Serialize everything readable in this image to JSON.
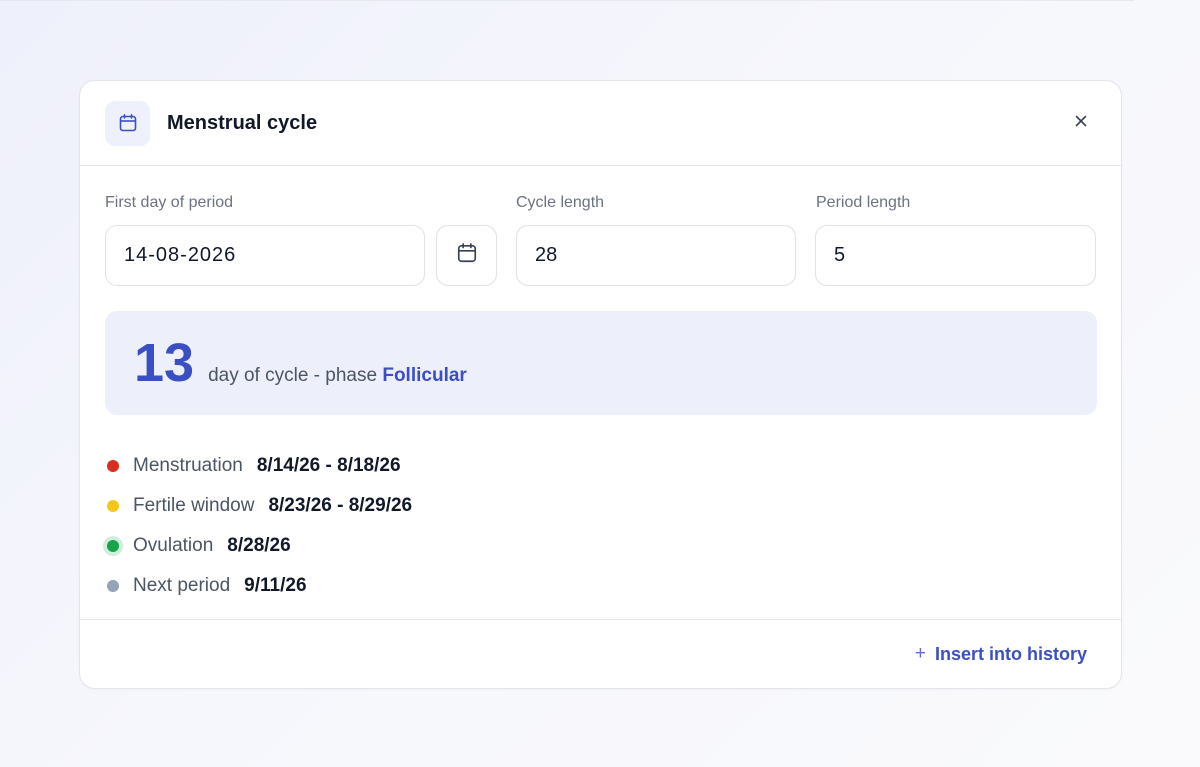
{
  "dialog": {
    "title": "Menstrual cycle",
    "header_icon": "calendar-icon",
    "close_icon": "close-icon"
  },
  "form": {
    "first_day_label": "First day of period",
    "first_day_value": "14-08-2026",
    "date_picker_icon": "calendar-icon",
    "cycle_length_label": "Cycle length",
    "cycle_length_value": "28",
    "period_length_label": "Period length",
    "period_length_value": "5"
  },
  "summary": {
    "day_number": "13",
    "text": "day of cycle - phase",
    "phase": "Follicular"
  },
  "events": [
    {
      "label": "Menstruation",
      "value": "8/14/26 - 8/18/26",
      "color": "#d92d20"
    },
    {
      "label": "Fertile window",
      "value": "8/23/26 - 8/29/26",
      "color": "#f5c518"
    },
    {
      "label": "Ovulation",
      "value": "8/28/26",
      "color": "#16a34a"
    },
    {
      "label": "Next period",
      "value": "9/11/26",
      "color": "#94a3b8"
    }
  ],
  "footer": {
    "insert_icon": "plus-icon",
    "insert_label": "Insert into history"
  },
  "colors": {
    "accent": "#3b4fc4",
    "summary_bg": "#edeffb"
  }
}
